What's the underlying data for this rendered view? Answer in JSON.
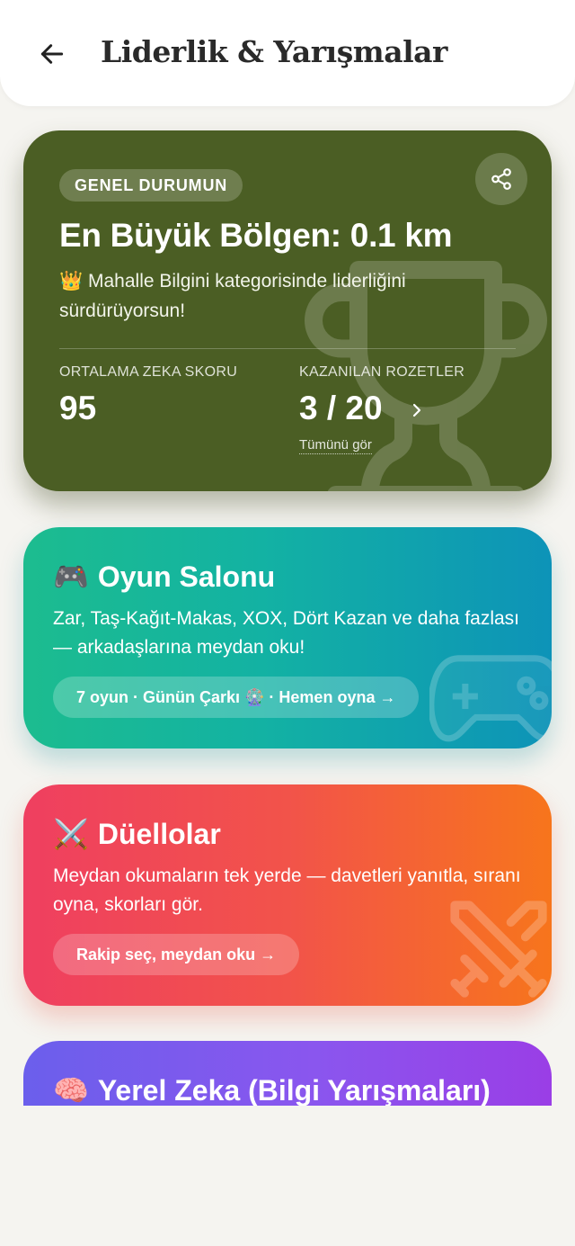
{
  "header": {
    "title": "Liderlik & Yarışmalar"
  },
  "status": {
    "chip": "GENEL DURUMUN",
    "headline": "En Büyük Bölgen: 0.1 km",
    "desc_emoji": "👑",
    "desc": "Mahalle Bilgini kategorisinde liderliğini sürdürüyorsun!",
    "stats": {
      "iq_label": "ORTALAMA ZEKA SKORU",
      "iq_value": "95",
      "badges_label": "KAZANILAN ROZETLER",
      "badges_value": "3 / 20",
      "badges_link": "Tümünü gör"
    },
    "color": "#4b5e24"
  },
  "game": {
    "emoji": "🎮",
    "title": "Oyun Salonu",
    "desc": "Zar, Taş-Kağıt-Makas, XOX, Dört Kazan ve daha fazlası — arkadaşlarına meydan oku!",
    "pill": "7 oyun · Günün Çarkı 🎡 · Hemen oyna →"
  },
  "duel": {
    "emoji": "⚔️",
    "title": "Düellolar",
    "desc": "Meydan okumaların tek yerde — davetleri yanıtla, sıranı oyna, skorları gör.",
    "pill": "Rakip seç, meydan oku →"
  },
  "quiz": {
    "emoji": "🧠",
    "title": "Yerel Zeka (Bilgi Yarışmaları)"
  },
  "icons": {
    "back": "arrow-left-icon",
    "share": "share-icon",
    "trophy": "trophy-icon",
    "chevron": "chevron-right-icon",
    "gamepad": "gamepad-icon",
    "swords": "swords-icon"
  }
}
